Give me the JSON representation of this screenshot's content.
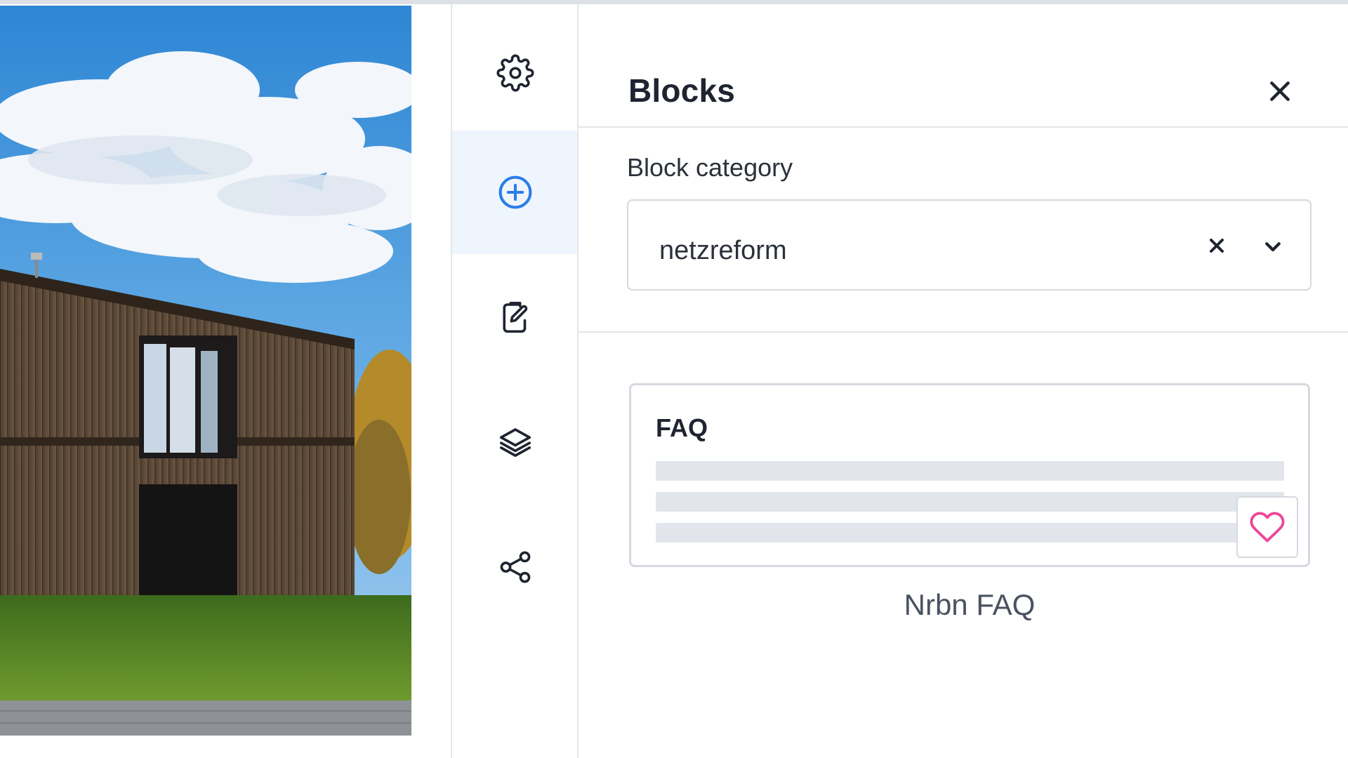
{
  "rail": {
    "items": [
      {
        "name": "settings",
        "icon": "gear-icon",
        "active": false
      },
      {
        "name": "add-block",
        "icon": "plus-circle-icon",
        "active": true
      },
      {
        "name": "edit",
        "icon": "edit-note-icon",
        "active": false
      },
      {
        "name": "layers",
        "icon": "layers-icon",
        "active": false
      },
      {
        "name": "share",
        "icon": "share-icon",
        "active": false
      }
    ],
    "active_color": "#2b7de9"
  },
  "panel": {
    "title": "Blocks",
    "close_icon": "close-icon",
    "category_label": "Block category",
    "category_value": "netzreform",
    "clear_icon": "clear-icon",
    "dropdown_icon": "chevron-down-icon"
  },
  "blocks": [
    {
      "card_title": "FAQ",
      "name": "Nrbn FAQ",
      "favorite_icon": "heart-icon",
      "favorite_color": "#ec4899"
    }
  ],
  "preview": {
    "image": "building-photo"
  }
}
